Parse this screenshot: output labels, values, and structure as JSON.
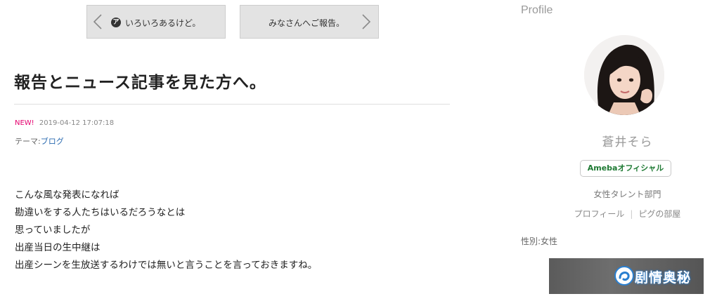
{
  "pager": {
    "prev_label": "いろいろあるけど。",
    "next_label": "みなさんへご報告。"
  },
  "article": {
    "title": "報告とニュース記事を見た方へ。",
    "new_badge": "NEW!",
    "timestamp": "2019-04-12 17:07:18",
    "theme_label": "テーマ:",
    "theme_value": "ブログ",
    "body_lines": [
      "こんな風な発表になれば",
      "勘違いをする人たちはいるだろうなとは",
      "思っていましたが",
      "出産当日の生中継は",
      "出産シーンを生放送するわけでは無いと言うことを言っておきますね。"
    ]
  },
  "sidebar": {
    "heading": "Profile",
    "name": "蒼井そら",
    "official_badge": "Amebaオフィシャル",
    "category": "女性タレント部門",
    "links": [
      "プロフィール",
      "ピグの部屋"
    ],
    "gender": "性別:女性"
  },
  "watermark": {
    "text": "剧情奥秘"
  },
  "colors": {
    "new_badge": "#e4006e",
    "link": "#2a6ab0",
    "official_green": "#1f7a34",
    "watermark_glow": "#2a7fd0"
  }
}
